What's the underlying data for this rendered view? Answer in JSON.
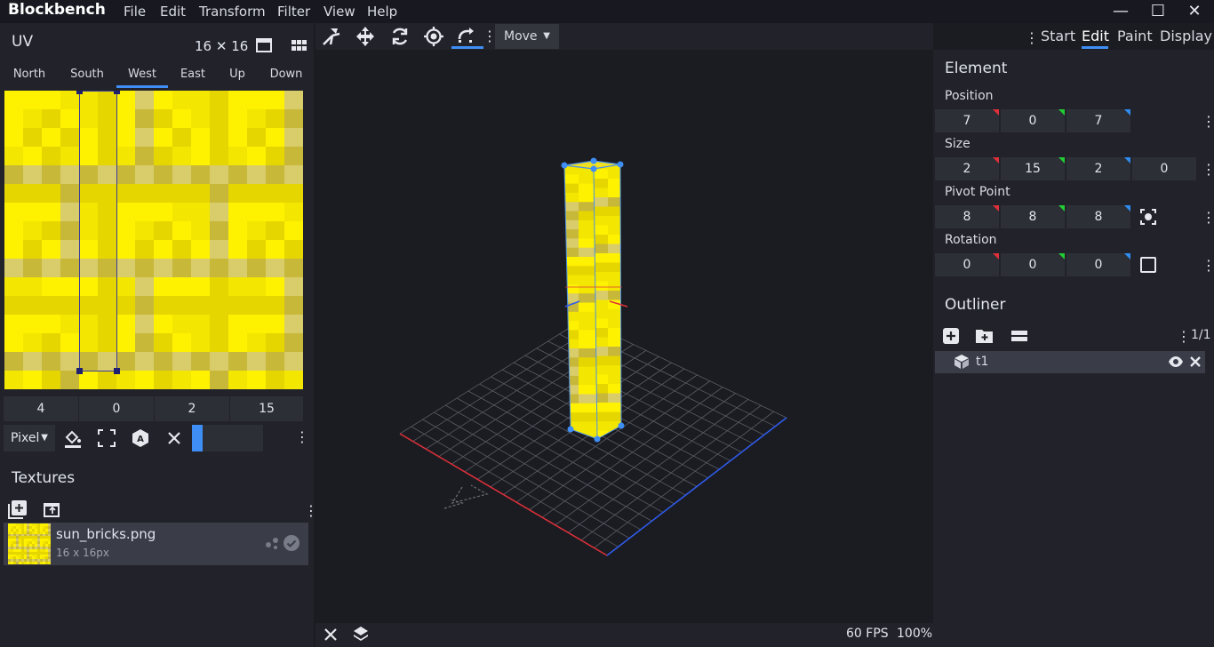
{
  "app": {
    "title": "Blockbench"
  },
  "menu": [
    "File",
    "Edit",
    "Transform",
    "Filter",
    "View",
    "Help"
  ],
  "window_controls": {
    "minimize": "—",
    "maximize": "☐",
    "close": "✕"
  },
  "uv": {
    "title": "UV",
    "size_label": "16 ✕ 16",
    "faces": [
      "North",
      "South",
      "West",
      "East",
      "Up",
      "Down"
    ],
    "active_face": "West",
    "values": [
      "4",
      "0",
      "2",
      "15"
    ],
    "mode": "Pixel"
  },
  "textures": {
    "title": "Textures",
    "items": [
      {
        "name": "sun_bricks.png",
        "info": "16 x 16px"
      }
    ]
  },
  "toolbar": {
    "move_label": "Move"
  },
  "modes": [
    "Start",
    "Edit",
    "Paint",
    "Display"
  ],
  "active_mode": "Edit",
  "viewport": {
    "fps": "60 FPS",
    "zoom": "100%"
  },
  "element": {
    "title": "Element",
    "position_label": "Position",
    "position": [
      "7",
      "0",
      "7"
    ],
    "size_label": "Size",
    "size": [
      "2",
      "15",
      "2",
      "0"
    ],
    "pivot_label": "Pivot Point",
    "pivot": [
      "8",
      "8",
      "8"
    ],
    "rotation_label": "Rotation",
    "rotation": [
      "0",
      "0",
      "0"
    ]
  },
  "outliner": {
    "title": "Outliner",
    "count": "1/1",
    "items": [
      {
        "name": "t1"
      }
    ]
  },
  "colors": {
    "accent": "#3e8ef5",
    "texture_yellow": "#f3e600",
    "axis_x": "#e0303a",
    "axis_z": "#2f5cf0"
  }
}
